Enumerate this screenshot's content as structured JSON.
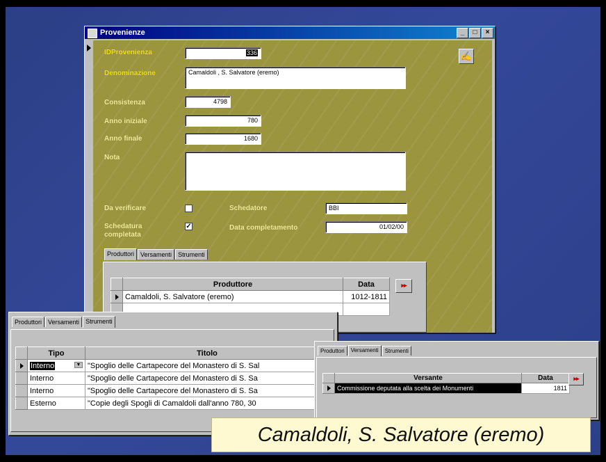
{
  "main_window": {
    "title": "Provenienze",
    "controls": [
      "_",
      "□",
      "×"
    ],
    "fields": {
      "id_label": "IDProvenienza",
      "id_value": "336",
      "denom_label": "Denominazione",
      "denom_value": "Camaldoli , S. Salvatore (eremo)",
      "consistenza_label": "Consistenza",
      "consistenza_value": "4798",
      "anno_iniz_label": "Anno iniziale",
      "anno_iniz_value": "780",
      "anno_fin_label": "Anno finale",
      "anno_fin_value": "1680",
      "nota_label": "Nota",
      "nota_value": "",
      "verificare_label": "Da verificare",
      "verificare_checked": false,
      "completata_label": "Schedatura completata",
      "completata_checked": true,
      "schedatore_label": "Schedatore",
      "schedatore_value": "BBI",
      "data_compl_label": "Data completamento",
      "data_compl_value": "01/02/00"
    },
    "tabs": [
      "Produttori",
      "Versamenti",
      "Strumenti"
    ],
    "produttori_grid": {
      "headers": [
        "Produttore",
        "Data"
      ],
      "rows": [
        [
          "Camaldoli, S. Salvatore (eremo)",
          "1012-1811"
        ]
      ]
    },
    "nav_button": "▸▸"
  },
  "strumenti_window": {
    "tabs": [
      "Produttori",
      "Versamenti",
      "Strumenti"
    ],
    "headers": [
      "Tipo",
      "Titolo"
    ],
    "rows": [
      [
        "Interno",
        "\"Spoglio delle Cartapecore del Monastero di S. Sal"
      ],
      [
        "Interno",
        "\"Spoglio delle Cartapecore del Monastero di S. Sa"
      ],
      [
        "Interno",
        "\"Spoglio delle Cartapecore del Monastero di S. Sa"
      ],
      [
        "Esterno",
        "\"Copie degli Spogli di Camaldoli dall'anno 780, 30"
      ]
    ]
  },
  "versamenti_window": {
    "tabs": [
      "Produttori",
      "Versamenti",
      "Strumenti"
    ],
    "headers": [
      "Versante",
      "Data"
    ],
    "rows": [
      [
        "Commissione deputata alla scelta dei Monumenti",
        "1811"
      ]
    ],
    "nav_button": "▸▸"
  },
  "caption": "Camaldoli, S. Salvatore (eremo)"
}
